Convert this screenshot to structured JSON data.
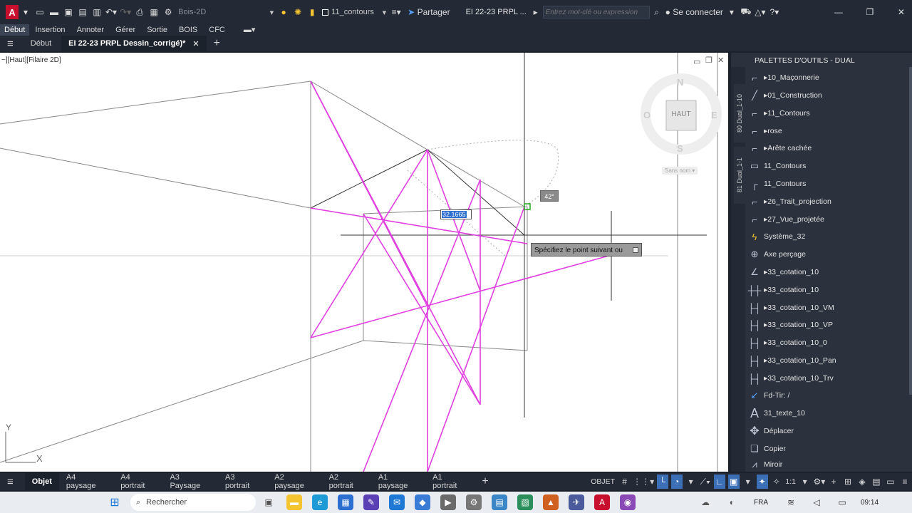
{
  "app": {
    "logo_letter": "A",
    "workspace": "Bois-2D",
    "layer": "11_contours",
    "share_label": "Partager",
    "doc_title": "EI 22-23 PRPL ...",
    "search_placeholder": "Entrez mot-clé ou expression",
    "login_label": "Se connecter"
  },
  "ribbon": {
    "tabs": [
      "Début",
      "Insertion",
      "Annoter",
      "Gérer",
      "Sortie",
      "BOIS",
      "CFC"
    ]
  },
  "doc_tabs": {
    "home": "Début",
    "active": "EI 22-23 PRPL Dessin_corrigé)*"
  },
  "canvas": {
    "view_label": "−][Haut][Filaire 2D]",
    "input_value": "32.1665",
    "angle_value": "42°",
    "prompt": "Spécifiez le point suivant ou",
    "viewcube": {
      "top": "HAUT",
      "n": "N",
      "s": "S",
      "e": "E",
      "o": "O",
      "ucs": "Sans nom"
    },
    "axis_y": "Y",
    "axis_x": "X"
  },
  "palette": {
    "title": "PALETTES D'OUTILS - DUAL",
    "side_tabs": [
      "80 Dual_1-10",
      "81 Dual_1-1"
    ],
    "items": [
      {
        "label": "10_Maçonnerie",
        "icon": "line-icon",
        "arrow": true
      },
      {
        "label": "01_Construction",
        "icon": "diagonal-line-icon",
        "arrow": true
      },
      {
        "label": "11_Contours",
        "icon": "line-icon",
        "arrow": true
      },
      {
        "label": "rose",
        "icon": "line-icon",
        "arrow": true
      },
      {
        "label": "Arête cachée",
        "icon": "line-icon",
        "arrow": true
      },
      {
        "label": "11_Contours",
        "icon": "rectangle-icon",
        "arrow": false
      },
      {
        "label": "11_Contours",
        "icon": "corner-icon",
        "arrow": false
      },
      {
        "label": "26_Trait_projection",
        "icon": "line-icon",
        "arrow": true
      },
      {
        "label": "27_Vue_projetée",
        "icon": "line-icon",
        "arrow": true
      },
      {
        "label": "Système_32",
        "icon": "lightning-icon",
        "arrow": false
      },
      {
        "label": "Axe perçage",
        "icon": "crosshair-icon",
        "arrow": false
      },
      {
        "label": "33_cotation_10",
        "icon": "angle-icon",
        "arrow": true
      },
      {
        "label": "33_cotation_10",
        "icon": "dimension-icon",
        "arrow": true
      },
      {
        "label": "33_cotation_10_VM",
        "icon": "dimension-icon",
        "arrow": true
      },
      {
        "label": "33_cotation_10_VP",
        "icon": "dimension-icon",
        "arrow": true
      },
      {
        "label": "33_cotation_10_0",
        "icon": "dimension-icon",
        "arrow": true
      },
      {
        "label": "33_cotation_10_Pan",
        "icon": "dimension-icon",
        "arrow": true
      },
      {
        "label": "33_cotation_10_Trv",
        "icon": "dimension-icon",
        "arrow": true
      },
      {
        "label": "Fd-Tir: /",
        "icon": "leader-icon",
        "arrow": false
      },
      {
        "label": "31_texte_10",
        "icon": "text-icon",
        "arrow": false
      },
      {
        "label": "Déplacer",
        "icon": "move-icon",
        "arrow": false
      },
      {
        "label": "Copier",
        "icon": "copy-icon",
        "arrow": false
      },
      {
        "label": "Miroir",
        "icon": "mirror-icon",
        "arrow": false
      }
    ]
  },
  "layouts": {
    "tabs": [
      "Objet",
      "A4 paysage",
      "A4 portrait",
      "A3 Paysage",
      "A3 portrait",
      "A2 paysage",
      "A2 portrait",
      "A1 paysage",
      "A1 portrait"
    ]
  },
  "status": {
    "mode": "OBJET",
    "scale": "1:1"
  },
  "taskbar": {
    "search": "Rechercher",
    "lang": "FRA",
    "time": "09:14"
  },
  "colors": {
    "magenta": "#e040e0",
    "accent": "#3b6fb6",
    "brand": "#c8102e"
  }
}
